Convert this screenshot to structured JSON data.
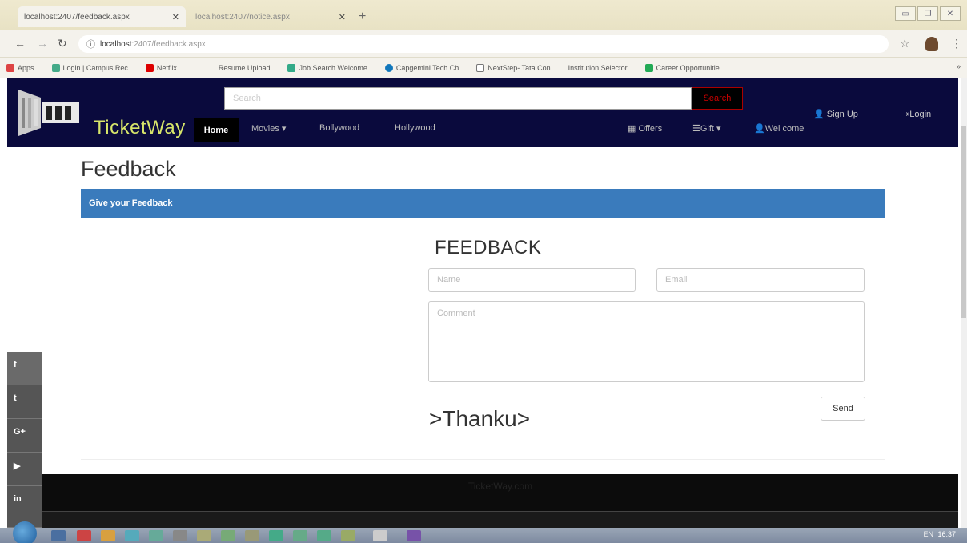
{
  "browser": {
    "tabs": [
      {
        "title": "localhost:2407/feedback.aspx",
        "active": true
      },
      {
        "title": "localhost:2407/notice.aspx",
        "active": false
      }
    ],
    "url_host": "localhost",
    "url_rest": ":2407/feedback.aspx",
    "bookmarks": [
      {
        "label": "Apps",
        "color": "#d44"
      },
      {
        "label": "Login | Campus Rec",
        "color": "#4a8"
      },
      {
        "label": "Netflix",
        "color": "#d00"
      },
      {
        "label": "Resume Upload",
        "color": "#888"
      },
      {
        "label": "Job Search Welcome",
        "color": "#3a8"
      },
      {
        "label": "Capgemini Tech Ch",
        "color": "#17b"
      },
      {
        "label": "NextStep- Tata Con",
        "color": "#777"
      },
      {
        "label": "Institution Selector",
        "color": "#888"
      },
      {
        "label": "Career Opportunitie",
        "color": "#2a5"
      }
    ],
    "bookmarks_more": "»"
  },
  "site": {
    "brand": "TicketWay",
    "search_placeholder": "Search",
    "search_button": "Search",
    "nav": {
      "home": "Home",
      "movies": "Movies ▾",
      "bollywood": "Bollywood",
      "hollywood": "Hollywood",
      "offers": "Offers",
      "gift": "Gift ▾",
      "welcome": "Wel come",
      "signup": "Sign Up",
      "login": "Login"
    }
  },
  "content": {
    "page_title": "Feedback",
    "panel_heading": "Give your Feedback",
    "form_title": "FEEDBACK",
    "name_placeholder": "Name",
    "email_placeholder": "Email",
    "comment_placeholder": "Comment",
    "send_label": "Send",
    "thanks_text": ">Thanku>"
  },
  "footer": {
    "text": "TicketWay.com"
  },
  "social": [
    "f",
    "t",
    "G+",
    "▶",
    "in"
  ],
  "taskbar": {
    "lang": "EN",
    "time": "16:37"
  }
}
